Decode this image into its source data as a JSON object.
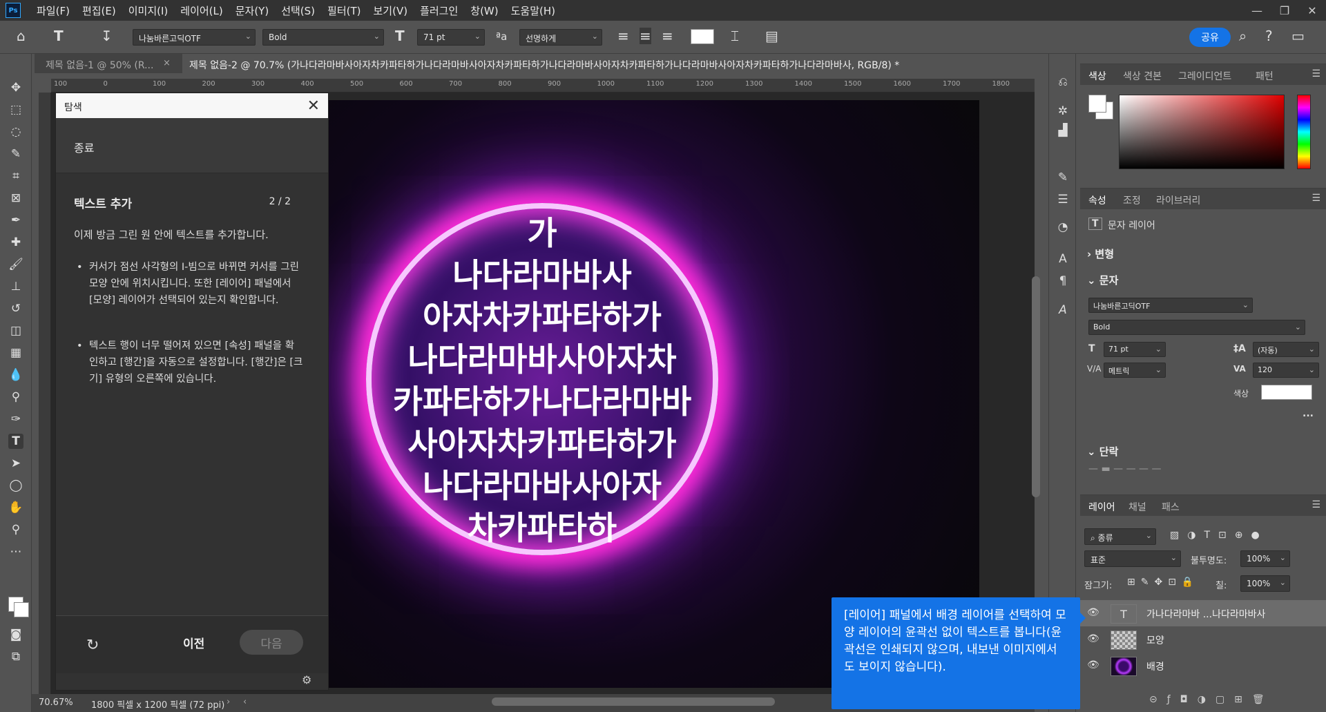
{
  "app": {
    "logo": "Ps"
  },
  "menu": [
    "파일(F)",
    "편집(E)",
    "이미지(I)",
    "레이어(L)",
    "문자(Y)",
    "선택(S)",
    "필터(T)",
    "보기(V)",
    "플러그인",
    "창(W)",
    "도움말(H)"
  ],
  "options": {
    "font_family": "나눔바른고딕OTF",
    "font_style": "Bold",
    "font_size": "71 pt",
    "antialias": "선명하게",
    "share_label": "공유"
  },
  "tabs": [
    {
      "label": "제목 없음-1 @ 50% (R...",
      "active": false
    },
    {
      "label": "제목 없음-2 @ 70.7% (가나다라마바사아자차카파타하가나다라마바사아자차카파타하가나다라마바사아자차카파타하가나다라마바사아자차카파타하가나다라마바사, RGB/8) *",
      "active": true
    }
  ],
  "ruler_ticks": [
    "100",
    "0",
    "100",
    "200",
    "300",
    "400",
    "500",
    "600",
    "700",
    "800",
    "900",
    "1000",
    "1100",
    "1200",
    "1300",
    "1400",
    "1500",
    "1600",
    "1700",
    "1800"
  ],
  "canvas": {
    "lines": [
      "가",
      "나다라마바사",
      "아자차카파타하가",
      "나다라마바사아자차",
      "카파타하가나다라마바",
      "사아자차카파타하가",
      "나다라마바사아자",
      "차카파타하"
    ]
  },
  "discover": {
    "header": "탐색",
    "end_label": "종료",
    "step_title": "텍스트 추가",
    "step_count": "2 / 2",
    "intro": "이제 방금 그린 원 안에 텍스트를 추가합니다.",
    "bullets": [
      "커서가 점선 사각형의 I-빔으로 바뀌면 커서를 그린 모양 안에 위치시킵니다. 또한 [레이어] 패널에서 [모양] 레이어가 선택되어 있는지 확인합니다.",
      "텍스트 행이 너무 떨어져 있으면 [속성] 패널을 확인하고 [행간]을 자동으로 설정합니다. [행간]은 [크기] 유형의 오른쪽에 있습니다."
    ],
    "prev_label": "이전",
    "next_label": "다음"
  },
  "status": {
    "zoom": "70.67%",
    "doc_info": "1800 픽셀 x 1200 픽셀 (72 ppi)"
  },
  "color_panel": {
    "tabs": [
      "색상",
      "색상 견본",
      "그레이디언트",
      "패턴"
    ]
  },
  "properties_panel": {
    "tabs": [
      "속성",
      "조정",
      "라이브러리"
    ],
    "layer_type": "문자 레이어",
    "transform_label": "변형",
    "character_label": "문자",
    "font_family": "나눔바른고딕OTF",
    "font_style": "Bold",
    "font_size": "71 pt",
    "leading": "(자동)",
    "kerning": "메트릭",
    "tracking": "120",
    "color_label": "색상",
    "paragraph_label": "단락",
    "more": "..."
  },
  "layers_panel": {
    "tabs": [
      "레이어",
      "채널",
      "패스"
    ],
    "filter_kind": "종류",
    "blend_mode": "표준",
    "opacity_label": "불투명도:",
    "opacity": "100%",
    "lock_label": "잠그기:",
    "fill_label": "칠:",
    "fill": "100%",
    "layers": [
      {
        "name": "가나다라마바 ...나다라마바사",
        "thumb": "T",
        "selected": true
      },
      {
        "name": "모양",
        "thumb": "",
        "selected": false
      },
      {
        "name": "배경",
        "thumb": "",
        "selected": false
      }
    ]
  },
  "tooltip": {
    "text": "[레이어] 패널에서 배경 레이어를 선택하여 모양 레이어의 윤곽선 없이 텍스트를 봅니다(윤곽선은 인쇄되지 않으며, 내보낸 이미지에서도 보이지 않습니다)."
  },
  "colors": {
    "accent": "#1473e6",
    "panel_bg": "#535353",
    "dark_bg": "#323232",
    "canvas_bg": "#282828"
  }
}
